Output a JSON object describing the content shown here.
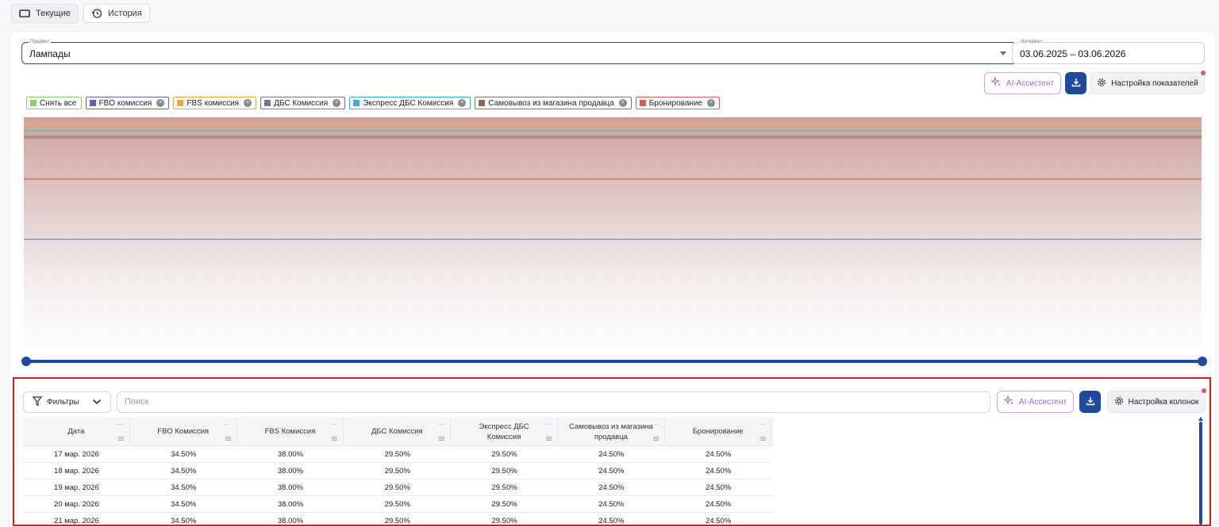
{
  "tabs": [
    {
      "label": "Текущие",
      "icon": "window-icon",
      "active": true
    },
    {
      "label": "История",
      "icon": "history-icon",
      "active": false
    }
  ],
  "filters": {
    "subject": {
      "label": "Предмет",
      "value": "Лампады"
    },
    "interval": {
      "label": "Интервал",
      "value": "03.06.2025 – 03.06.2026"
    }
  },
  "toolbar": {
    "ai_label": "AI-Ассистент",
    "download_icon": "download-icon",
    "settings_label": "Настройка показателей"
  },
  "legend_chips": [
    {
      "label": "Снять все",
      "color": "#86d36c",
      "removable": false
    },
    {
      "label": "FBO комиссия",
      "color": "#5b63b5",
      "removable": true
    },
    {
      "label": "FBS комиссия",
      "color": "#f0a63a",
      "removable": true
    },
    {
      "label": "ДБС Комиссия",
      "color": "#6f7b87",
      "removable": true
    },
    {
      "label": "Экспресс ДБС Комиссия",
      "color": "#3aaed8",
      "removable": true
    },
    {
      "label": "Самовывоз из магазина продавца",
      "color": "#8a6a5a",
      "removable": true
    },
    {
      "label": "Бронирование",
      "color": "#e05a5a",
      "removable": true
    }
  ],
  "chart_data": {
    "type": "area",
    "series": [
      {
        "name": "FBS комиссия",
        "color": "#f0a63a",
        "values": [
          38.0,
          38.0
        ]
      },
      {
        "name": "FBO комиссия",
        "color": "#5b63b5",
        "values": [
          34.5,
          34.5
        ]
      },
      {
        "name": "ДБС Комиссия",
        "color": "#6f7b87",
        "values": [
          29.5,
          29.5
        ]
      },
      {
        "name": "Экспресс ДБС Комиссия",
        "color": "#3aaed8",
        "values": [
          29.5,
          29.5
        ]
      },
      {
        "name": "Самовывоз из магазина продавца",
        "color": "#8a6a5a",
        "values": [
          24.5,
          24.5
        ]
      },
      {
        "name": "Бронирование",
        "color": "#e05a5a",
        "values": [
          24.5,
          24.5
        ]
      }
    ],
    "grid": true
  },
  "table_toolbar": {
    "filters_label": "Фильтры",
    "search_placeholder": "Поиск",
    "ai_label": "AI-Ассистент",
    "settings_label": "Настройка колонок"
  },
  "table": {
    "columns": [
      "Дата",
      "FBO Комиссия",
      "FBS Комиссия",
      "ДБС Комиссия",
      "Экспресс ДБС Комиссия",
      "Самовывоз из магазина продавца",
      "Бронирование"
    ],
    "rows": [
      [
        "17 мар. 2026",
        "34.50%",
        "38.00%",
        "29.50%",
        "29.50%",
        "24.50%",
        "24.50%"
      ],
      [
        "18 мар. 2026",
        "34.50%",
        "38.00%",
        "29.50%",
        "29.50%",
        "24.50%",
        "24.50%"
      ],
      [
        "19 мар. 2026",
        "34.50%",
        "38.00%",
        "29.50%",
        "29.50%",
        "24.50%",
        "24.50%"
      ],
      [
        "20 мар. 2026",
        "34.50%",
        "38.00%",
        "29.50%",
        "29.50%",
        "24.50%",
        "24.50%"
      ],
      [
        "21 мар. 2026",
        "34.50%",
        "38.00%",
        "29.50%",
        "29.50%",
        "24.50%",
        "24.50%"
      ]
    ]
  },
  "colors": {
    "accent": "#1d4a9a",
    "ai": "#9b6bd0",
    "highlight": "#e01b1b"
  }
}
